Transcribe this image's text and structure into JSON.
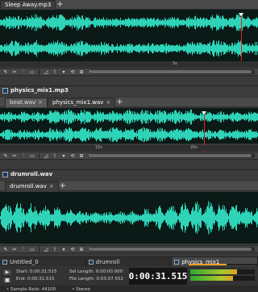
{
  "colors": {
    "waveform": "#2ed3b8",
    "waveform_bg": "#0b1a16",
    "playhead": "#e02020",
    "progress": "#f0a020"
  },
  "top": {
    "tab_label": "Sleep Away.mp3",
    "ruler_labels": [
      "5s"
    ],
    "toolbar_icons": [
      "pencil-icon",
      "cut-icon",
      "split-icon",
      "select-icon",
      "fade-icon",
      "envelope-icon",
      "marker-icon",
      "loop-icon",
      "snap-icon",
      "zoom-icon"
    ]
  },
  "physics": {
    "title": "physics_mix1.mp3",
    "tabs": [
      {
        "label": "beat.wav",
        "close": "×"
      },
      {
        "label": "physics_mix1.wav",
        "close": "×"
      }
    ],
    "ruler_labels": [
      "15s",
      "20s"
    ]
  },
  "drumroll": {
    "title": "drumroll.wav",
    "tab_label": "drumroll.wav",
    "close": "×"
  },
  "doc_tabs": [
    {
      "label": "Untitled_0",
      "icon": "document-icon"
    },
    {
      "label": "drumroll",
      "icon": "document-icon"
    },
    {
      "label": "physics_mix1",
      "icon": "document-icon"
    }
  ],
  "stats": {
    "start": "Start: 0:00:31.515",
    "end": "End: 0:00:31.515",
    "sel_length": "Sel Length: 0:00:00.000",
    "file_length": "File Length: 0:03:07.552"
  },
  "timecode": "0:00:31.515",
  "progress_fraction": 0.55,
  "meter_levels": [
    0.72,
    0.66
  ],
  "status": {
    "sample_rate": "Sample Rate: 44100",
    "channels": "Stereo"
  }
}
